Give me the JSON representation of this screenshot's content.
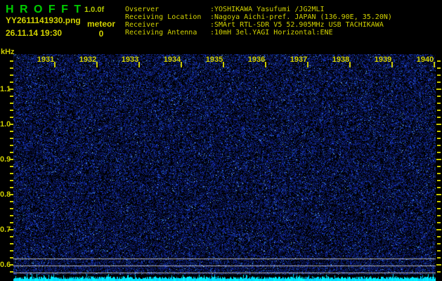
{
  "app": {
    "title": "H R O F F T",
    "version": "1.0.0f",
    "filename": "YY2611141930.png",
    "mode": "meteor",
    "datetime": "26.11.14 19:30",
    "count": "0"
  },
  "station_info": [
    {
      "label": "Ovserver",
      "value": ":YOSHIKAWA Yasufumi /JG2MLI"
    },
    {
      "label": "Receiving Location",
      "value": ":Nagoya Aichi-pref. JAPAN (136.90E, 35.20N)"
    },
    {
      "label": "Receiver",
      "value": ":SMArt RTL-SDR V5 52.905MHz USB TACHIKAWA"
    },
    {
      "label": "Receiving Antenna",
      "value": ":10mH 3el.YAGI Horizontal:ENE"
    }
  ],
  "spectrogram": {
    "y_axis_unit": "kHz",
    "y_major_labels": [
      "1.1",
      "1.0",
      "0.9",
      "0.8",
      "0.7",
      "0.6"
    ],
    "x_time_labels": [
      "1931",
      "1932",
      "1933",
      "1934",
      "1935",
      "1936",
      "1937",
      "1938",
      "1939",
      "1940"
    ],
    "level_reference_lines": 3,
    "colors": {
      "title_green": "#00cc00",
      "version_yellow_green": "#b4c800",
      "text_yellow": "#d2d200",
      "axis_yellow": "#c8c800",
      "noise_dim_blue": "#1a1a8c",
      "noise_mid_blue": "#2233dd",
      "noise_bright_speck": "#8cc8ff",
      "level_line_gray": "#b2b2b2",
      "noise_strip_cyan": "#00e4ff",
      "background": "#000000"
    }
  }
}
